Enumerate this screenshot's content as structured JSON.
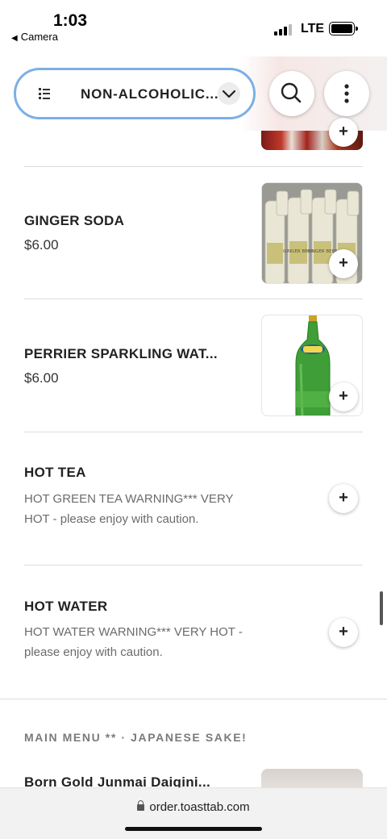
{
  "status_bar": {
    "time": "1:03",
    "back_app": "Camera",
    "network": "LTE"
  },
  "header": {
    "category": "NON-ALCOHOLIC...",
    "menu_icon": "list-icon",
    "dropdown_icon": "chevron-down-icon",
    "search_icon": "search-icon",
    "more_icon": "more-vertical-icon",
    "accent_color": "#7ab0e6"
  },
  "items": [
    {
      "name": "GINGER SODA",
      "price": "$6.00",
      "image": "ginger-beer-bottles",
      "image_label": "GINGER BEER",
      "add_label": "+"
    },
    {
      "name": "PERRIER SPARKLING WAT...",
      "price": "$6.00",
      "image": "perrier-bottle",
      "add_label": "+"
    },
    {
      "name": "HOT TEA",
      "description_lines": [
        "HOT GREEN TEA  WARNING*** VERY",
        "HOT - please enjoy with caution."
      ],
      "add_label": "+"
    },
    {
      "name": "HOT WATER",
      "description_lines": [
        "HOT WATER  WARNING*** VERY HOT -",
        "please enjoy with caution."
      ],
      "add_label": "+"
    }
  ],
  "top_item_add_label": "+",
  "next_section": {
    "title": "MAIN MENU ** · JAPANESE SAKE!",
    "first_item": "Born Gold Junmai Daigini..."
  },
  "url_bar": {
    "url": "order.toasttab.com"
  }
}
